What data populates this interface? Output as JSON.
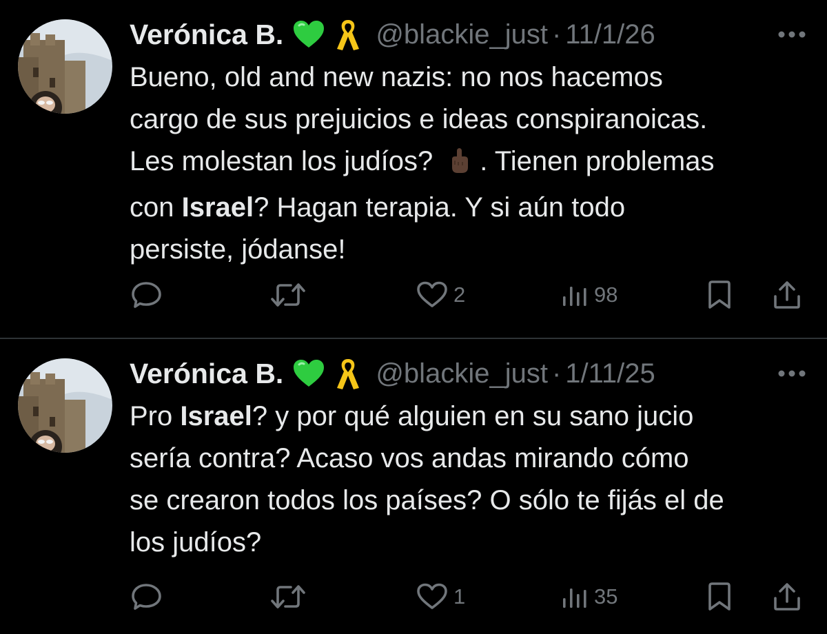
{
  "tweets": [
    {
      "author": {
        "display_name": "Verónica B.",
        "badges": [
          "green-heart-emoji",
          "yellow-ribbon-emoji"
        ],
        "handle": "@blackie_just",
        "separator": "·"
      },
      "date": "11/1/26",
      "text_lines": [
        "Bueno, old and new nazis: no nos hacemos",
        "cargo de sus prejuicios e ideas conspiranoicas.",
        [
          "Les molestan los judíos?",
          ". Tienen problemas"
        ],
        [
          "con ",
          "Israel",
          "? Hagan terapia. Y si aún todo"
        ],
        "persiste, jódanse!"
      ],
      "inline_emoji": "middle-finger-emoji",
      "bold_word": "Israel",
      "stats": {
        "replies": "",
        "retweets": "",
        "likes": "2",
        "views": "98"
      }
    },
    {
      "author": {
        "display_name": "Verónica B.",
        "badges": [
          "green-heart-emoji",
          "yellow-ribbon-emoji"
        ],
        "handle": "@blackie_just",
        "separator": "·"
      },
      "date": "1/11/25",
      "text_lines": [
        [
          "Pro ",
          "Israel",
          "? y por qué alguien en su sano jucio"
        ],
        "sería contra? Acaso vos andas mirando cómo",
        "se crearon todos los países? O sólo te fijás el de",
        "los judíos?"
      ],
      "bold_word": "Israel",
      "stats": {
        "replies": "",
        "retweets": "",
        "likes": "1",
        "views": "35"
      }
    }
  ],
  "colors": {
    "background": "#000000",
    "text": "#e7e9ea",
    "muted": "#71767b",
    "divider": "#2f3336",
    "heart_emoji": "#2ecc40",
    "ribbon_emoji": "#f5c518"
  }
}
